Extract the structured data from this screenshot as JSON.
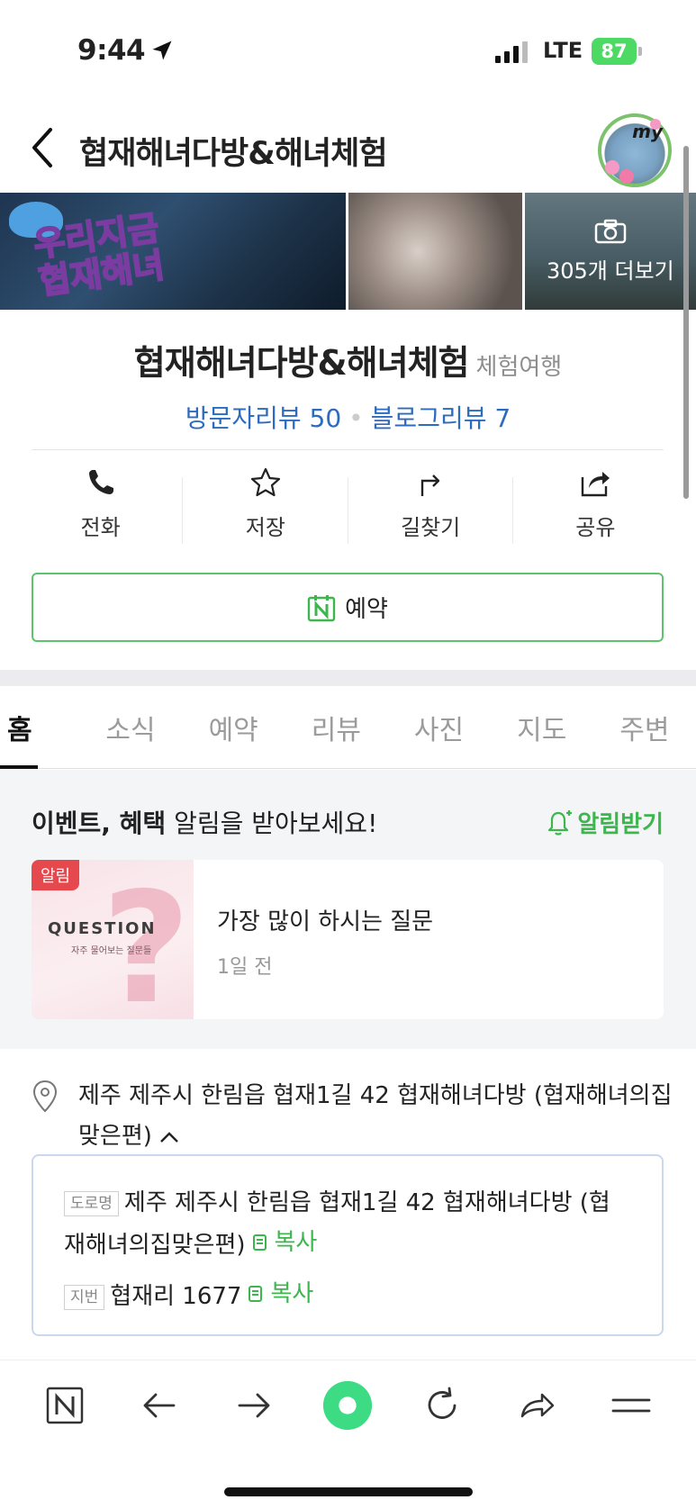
{
  "status_bar": {
    "time": "9:44",
    "network": "LTE",
    "battery": "87"
  },
  "header": {
    "title": "협재해녀다방&해녀체험",
    "my_label": "my"
  },
  "photos": {
    "photo1_text": "우리지금\n협재해녀",
    "more_label": "305개 더보기"
  },
  "place": {
    "name": "협재해녀다방&해녀체험",
    "category": "체험여행",
    "visitor_reviews": "방문자리뷰 50",
    "blog_reviews": "블로그리뷰 7"
  },
  "actions": [
    {
      "label": "전화",
      "icon": "phone-icon"
    },
    {
      "label": "저장",
      "icon": "star-icon"
    },
    {
      "label": "길찾기",
      "icon": "directions-icon"
    },
    {
      "label": "공유",
      "icon": "share-icon"
    }
  ],
  "reserve_label": "예약",
  "tabs": [
    "홈",
    "소식",
    "예약",
    "리뷰",
    "사진",
    "지도",
    "주변"
  ],
  "notice": {
    "title_bold": "이벤트, 혜택",
    "title_rest": " 알림을 받아보세요!",
    "alarm_label": "알림받기",
    "badge": "알림",
    "thumb_word": "QUESTION",
    "thumb_sub": "자주 물어보는 질문들",
    "card_title": "가장 많이 하시는 질문",
    "card_time": "1일 전"
  },
  "address": {
    "summary": "제주 제주시 한림읍 협재1길 42 협재해녀다방 (협재해녀의집맞은편)",
    "road_tag": "도로명",
    "road": "제주 제주시 한림읍 협재1길 42 협재해녀다방 (협재해녀의집맞은편)",
    "lot_tag": "지번",
    "lot": "협재리 1677",
    "copy_label": "복사"
  },
  "colors": {
    "accent_green": "#3cb64d",
    "link_blue": "#2d6bbf",
    "badge_red": "#e5484d"
  }
}
